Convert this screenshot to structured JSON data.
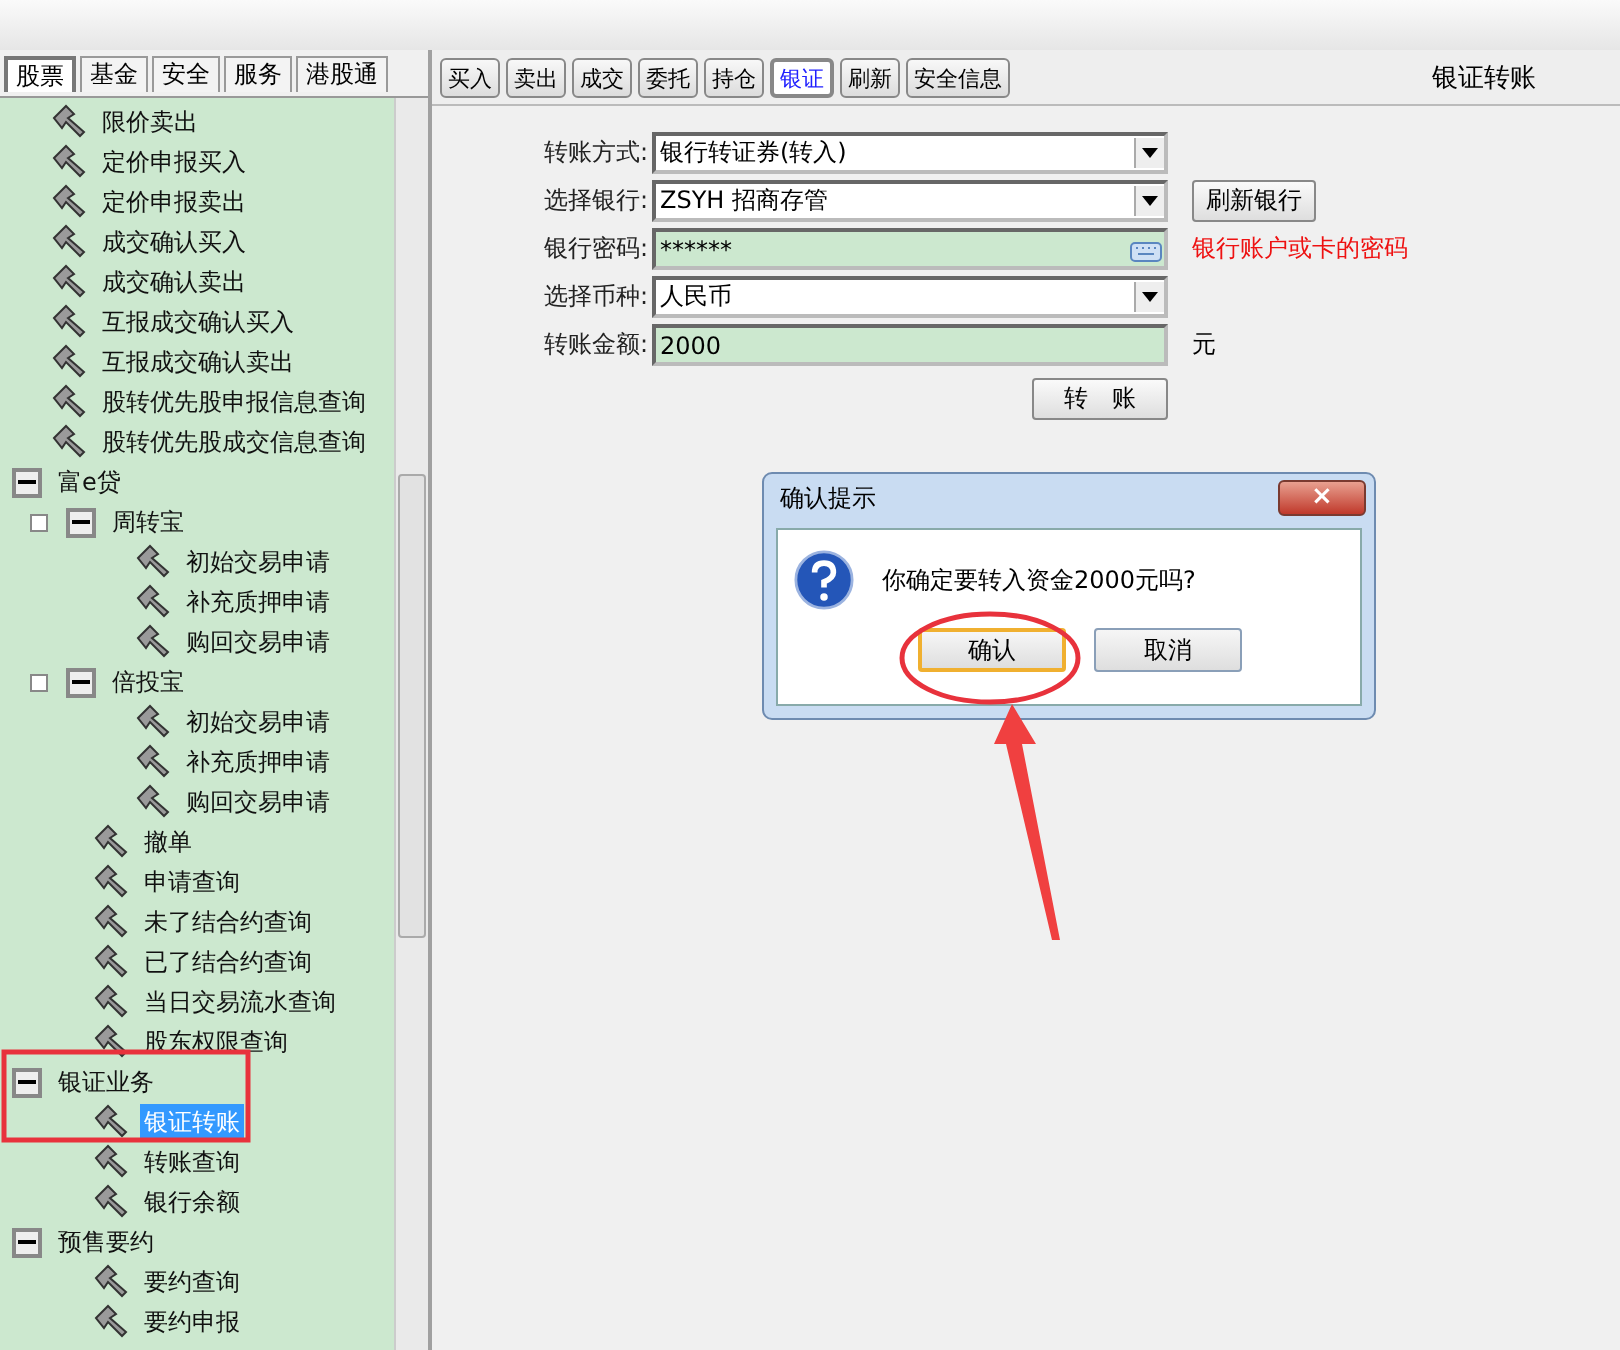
{
  "sidebar": {
    "tabs": [
      {
        "label": "股票",
        "selected": true
      },
      {
        "label": "基金",
        "selected": false
      },
      {
        "label": "安全",
        "selected": false
      },
      {
        "label": "服务",
        "selected": false
      },
      {
        "label": "港股通",
        "selected": false
      }
    ],
    "tree": [
      {
        "children": [
          {
            "label": "限价卖出",
            "selected": false
          },
          {
            "label": "定价申报买入",
            "selected": false
          },
          {
            "label": "定价申报卖出",
            "selected": false
          },
          {
            "label": "成交确认买入",
            "selected": false
          },
          {
            "label": "成交确认卖出",
            "selected": false
          },
          {
            "label": "互报成交确认买入",
            "selected": false
          },
          {
            "label": "互报成交确认卖出",
            "selected": false
          },
          {
            "label": "股转优先股申报信息查询",
            "selected": false
          },
          {
            "label": "股转优先股成交信息查询",
            "selected": false
          }
        ]
      },
      {
        "label": "富e贷",
        "expanded": true,
        "children": [
          {
            "label": "周转宝",
            "expanded": true,
            "children": [
              {
                "label": "初始交易申请",
                "selected": false
              },
              {
                "label": "补充质押申请",
                "selected": false
              },
              {
                "label": "购回交易申请",
                "selected": false
              }
            ]
          },
          {
            "label": "倍投宝",
            "expanded": true,
            "children": [
              {
                "label": "初始交易申请",
                "selected": false
              },
              {
                "label": "补充质押申请",
                "selected": false
              },
              {
                "label": "购回交易申请",
                "selected": false
              }
            ]
          },
          {
            "label": "撤单",
            "selected": false
          },
          {
            "label": "申请查询",
            "selected": false
          },
          {
            "label": "未了结合约查询",
            "selected": false
          },
          {
            "label": "已了结合约查询",
            "selected": false
          },
          {
            "label": "当日交易流水查询",
            "selected": false
          },
          {
            "label": "股东权限查询",
            "selected": false
          }
        ]
      },
      {
        "label": "银证业务",
        "expanded": true,
        "children": [
          {
            "label": "银证转账",
            "selected": true
          },
          {
            "label": "转账查询",
            "selected": false
          },
          {
            "label": "银行余额",
            "selected": false
          }
        ]
      },
      {
        "label": "预售要约",
        "expanded": true,
        "children": [
          {
            "label": "要约查询",
            "selected": false
          },
          {
            "label": "要约申报",
            "selected": false
          }
        ]
      }
    ]
  },
  "toolbar": {
    "buttons": [
      {
        "label": "买入",
        "selected": false
      },
      {
        "label": "卖出",
        "selected": false
      },
      {
        "label": "成交",
        "selected": false
      },
      {
        "label": "委托",
        "selected": false
      },
      {
        "label": "持仓",
        "selected": false
      },
      {
        "label": "银证",
        "selected": true
      },
      {
        "label": "刷新",
        "selected": false
      },
      {
        "label": "安全信息",
        "selected": false
      }
    ],
    "title": "银证转账"
  },
  "form": {
    "rows": [
      {
        "kind": "select",
        "label": "转账方式:",
        "value": "银行转证券(转入)"
      },
      {
        "kind": "select",
        "label": "选择银行:",
        "value": "ZSYH 招商存管",
        "button": "刷新银行"
      },
      {
        "kind": "password",
        "label": "银行密码:",
        "value": "******",
        "note": "银行账户或卡的密码"
      },
      {
        "kind": "select",
        "label": "选择币种:",
        "value": "人民币"
      },
      {
        "kind": "text",
        "label": "转账金额:",
        "value": "2000",
        "unit": "元"
      }
    ],
    "submit": "转　账"
  },
  "dialog": {
    "title": "确认提示",
    "close": "×",
    "message": "你确定要转入资金2000元吗?",
    "buttons": [
      {
        "label": "确认",
        "selected": true
      },
      {
        "label": "取消",
        "selected": false
      }
    ]
  }
}
